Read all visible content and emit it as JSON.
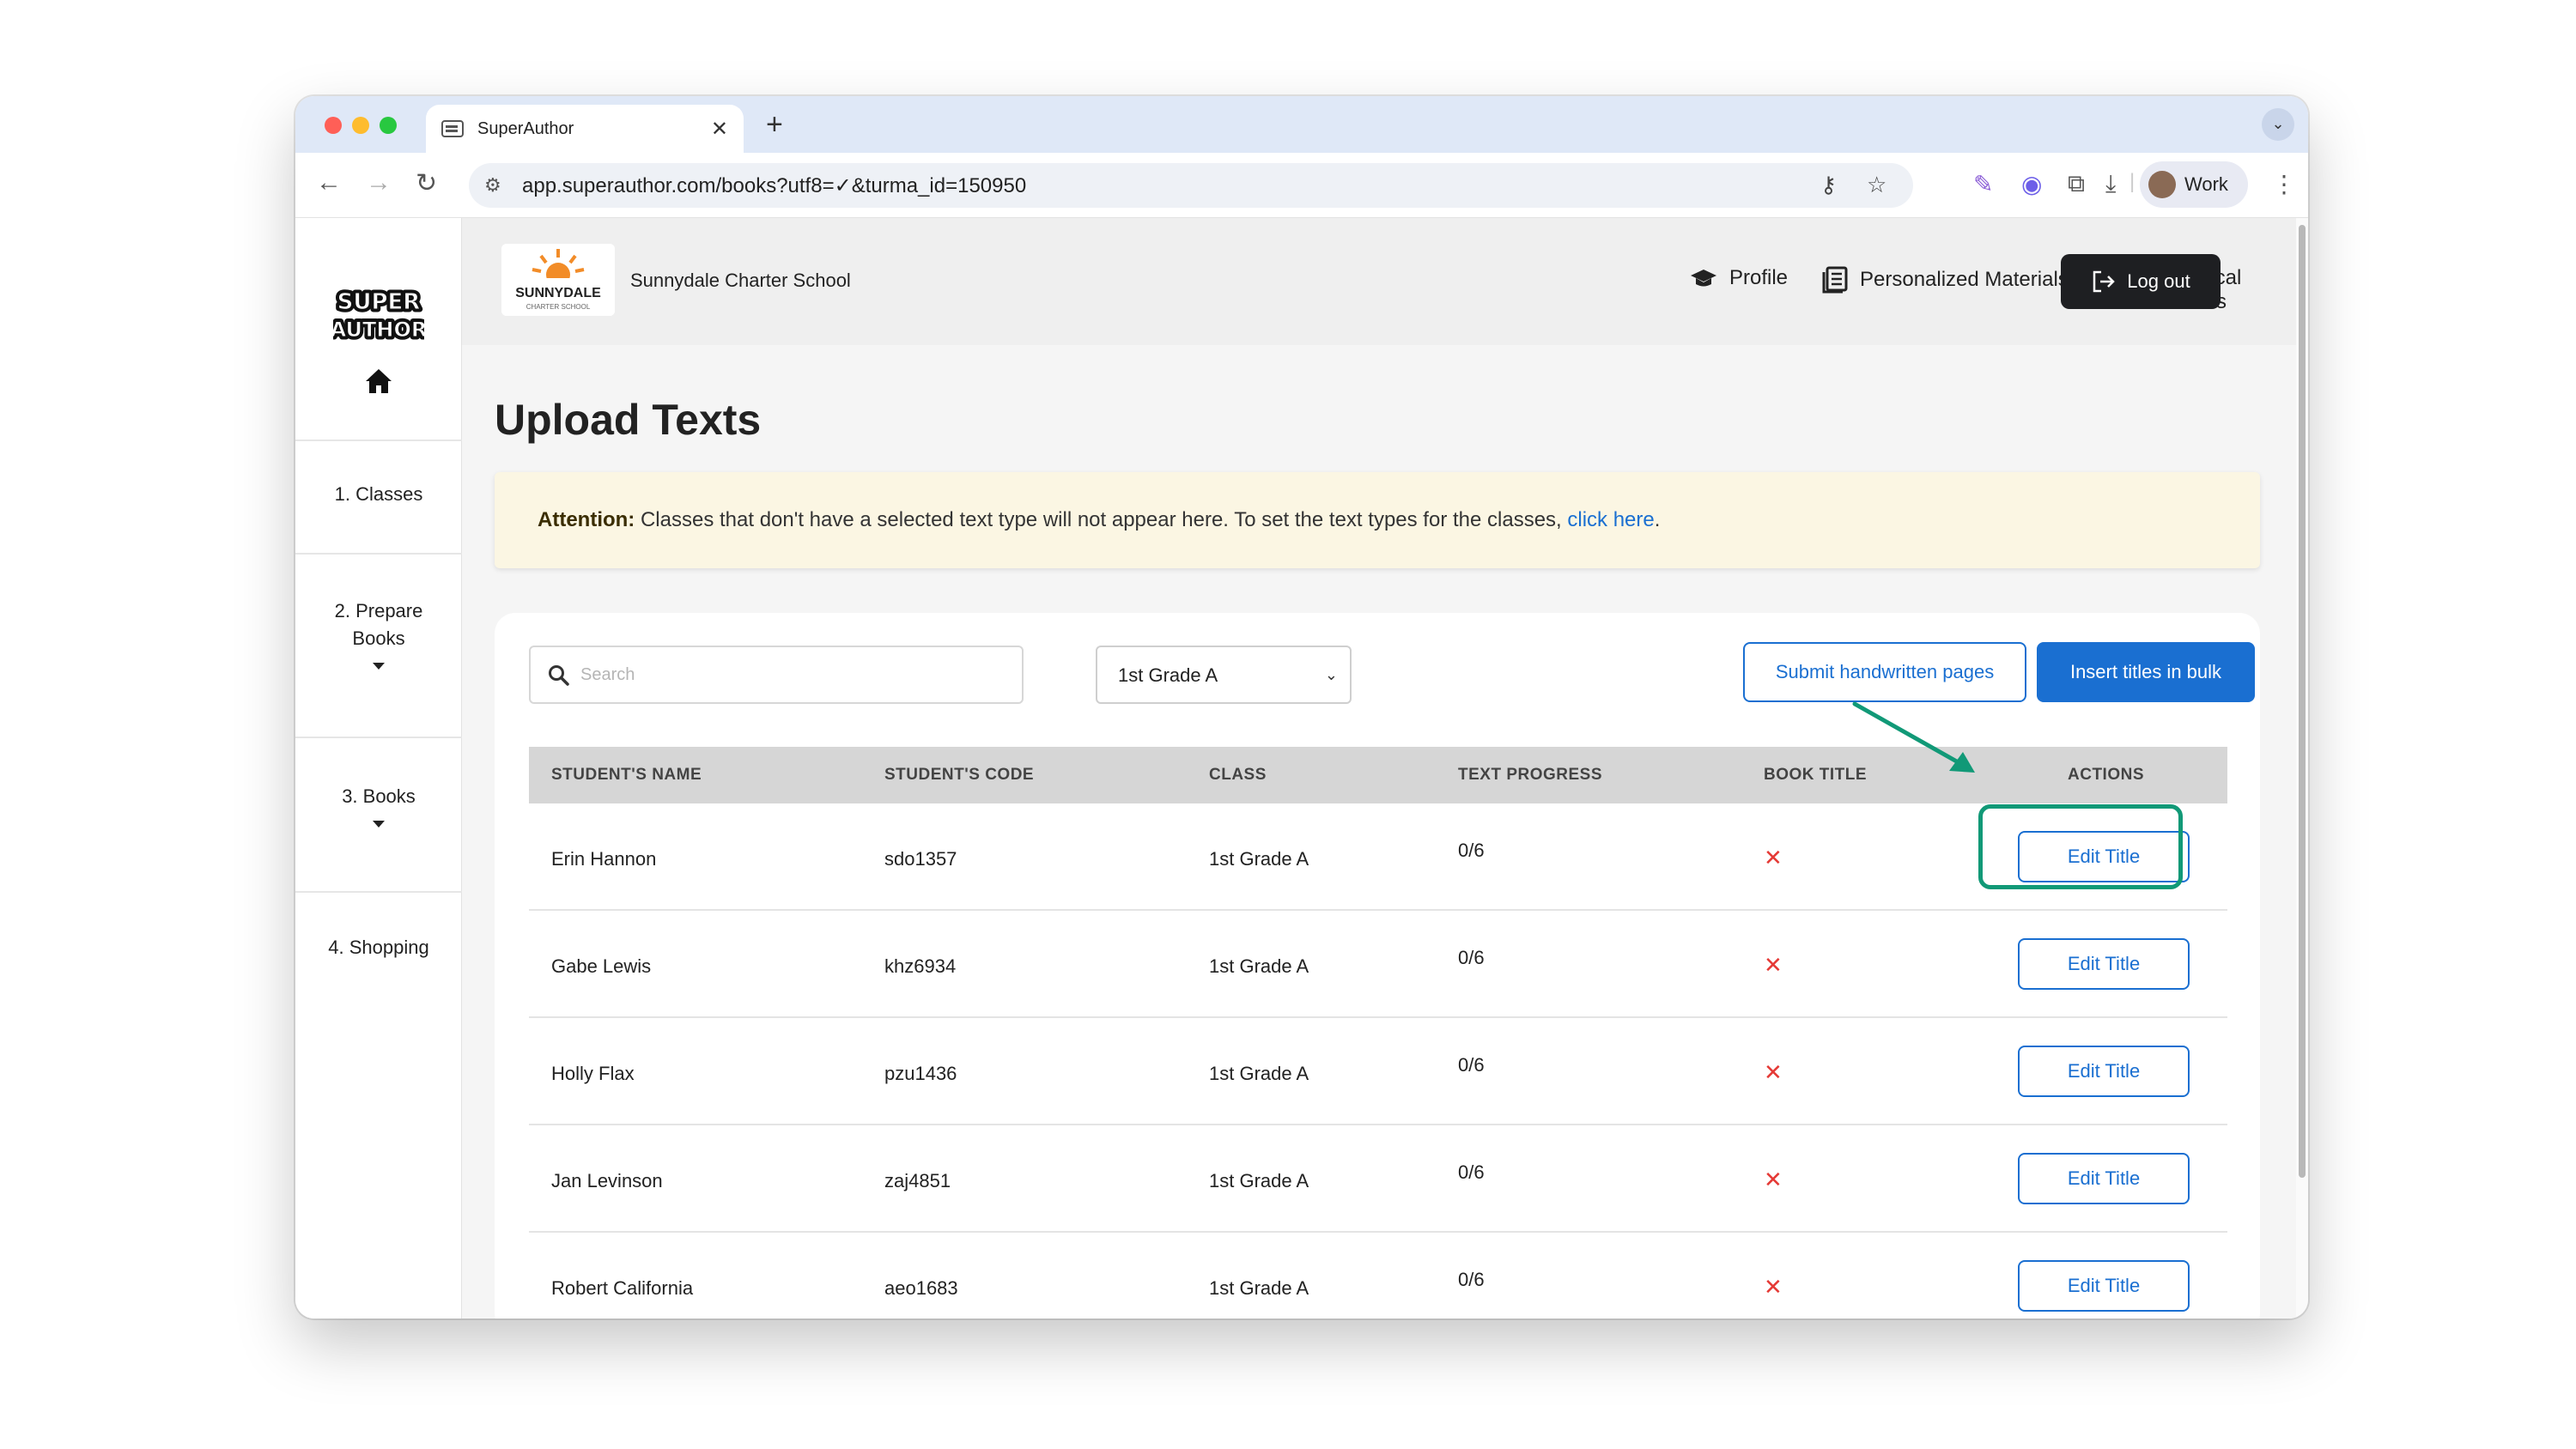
{
  "browser": {
    "tab_title": "SuperAuthor",
    "url": "app.superauthor.com/books?utf8=✓&turma_id=150950",
    "profile_name": "Work"
  },
  "sidebar": {
    "logo_text": "SUPER AUTHOR",
    "items": [
      {
        "label": "1. Classes"
      },
      {
        "label": "2. Prepare Books"
      },
      {
        "label": "3. Books"
      },
      {
        "label": "4. Shopping"
      }
    ]
  },
  "header": {
    "school_logo_text": "SUNNYDALE",
    "school_logo_subtext": "CHARTER SCHOOL",
    "school_name": "Sunnydale Charter School",
    "nav": {
      "profile": "Profile",
      "materials": "Personalized Materials",
      "resources": "Pedagogical Resources"
    },
    "logout": "Log out"
  },
  "main": {
    "title": "Upload Texts",
    "alert": {
      "strong": "Attention:",
      "text": "Classes that don't have a selected text type will not appear here. To set the text types for the classes,",
      "link": "click here",
      "end": "."
    },
    "search_placeholder": "Search",
    "class_select": "1st Grade A",
    "submit_button": "Submit handwritten pages",
    "bulk_button": "Insert titles in bulk",
    "table": {
      "headers": [
        "STUDENT'S NAME",
        "STUDENT'S CODE",
        "CLASS",
        "TEXT PROGRESS",
        "BOOK TITLE",
        "ACTIONS"
      ],
      "rows": [
        {
          "name": "Erin Hannon",
          "code": "sdo1357",
          "class": "1st Grade A",
          "progress": "0/6",
          "book_title": "✕",
          "action": "Edit Title"
        },
        {
          "name": "Gabe Lewis",
          "code": "khz6934",
          "class": "1st Grade A",
          "progress": "0/6",
          "book_title": "✕",
          "action": "Edit Title"
        },
        {
          "name": "Holly Flax",
          "code": "pzu1436",
          "class": "1st Grade A",
          "progress": "0/6",
          "book_title": "✕",
          "action": "Edit Title"
        },
        {
          "name": "Jan Levinson",
          "code": "zaj4851",
          "class": "1st Grade A",
          "progress": "0/6",
          "book_title": "✕",
          "action": "Edit Title"
        },
        {
          "name": "Robert California",
          "code": "aeo1683",
          "class": "1st Grade A",
          "progress": "0/6",
          "book_title": "✕",
          "action": "Edit Title"
        }
      ]
    }
  },
  "colors": {
    "primary": "#1a6fd1",
    "annotation": "#119977",
    "danger": "#e53935",
    "alert_bg": "#fbf6e3"
  }
}
